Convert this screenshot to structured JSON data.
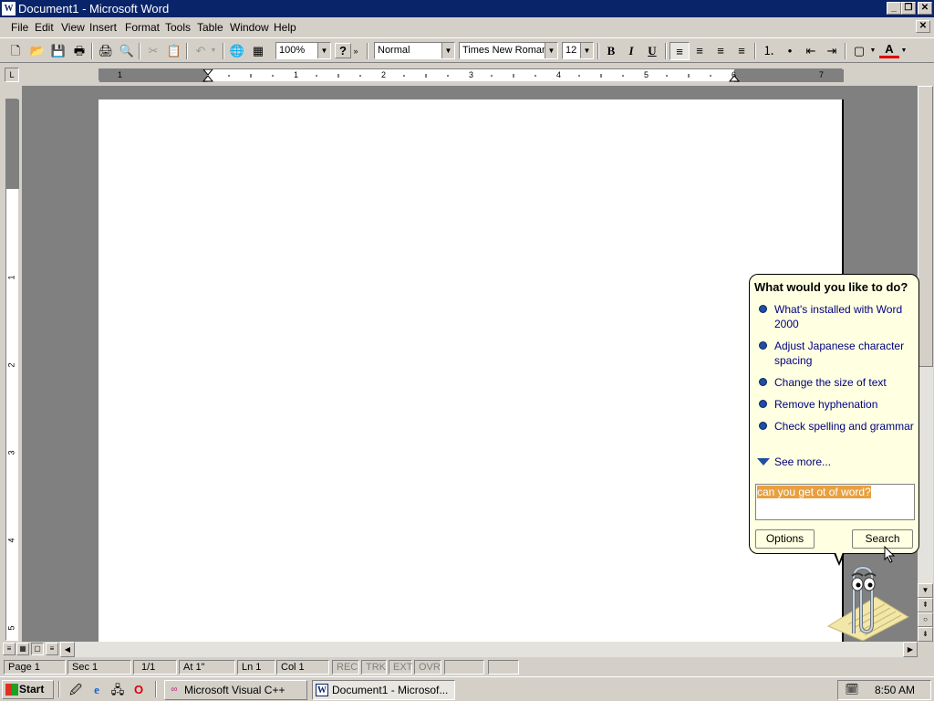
{
  "window": {
    "title": "Document1 - Microsoft Word",
    "app_icon_glyph": "W",
    "minimize_glyph": "_",
    "maximize_glyph": "❐",
    "close_glyph": "✕"
  },
  "menubar": {
    "items": [
      "File",
      "Edit",
      "View",
      "Insert",
      "Format",
      "Tools",
      "Table",
      "Window",
      "Help"
    ],
    "doc_close_glyph": "✕"
  },
  "toolbar": {
    "zoom": "100%",
    "style": "Normal",
    "font": "Times New Roman",
    "font_size": "12",
    "bold": "B",
    "italic": "I",
    "underline": "U",
    "font_color_glyph": "A",
    "help_glyph": "?",
    "dropdown_glyph": "▼",
    "overflow_glyph": "»",
    "icons": {
      "new": "🗋",
      "open": "📂",
      "save": "💾",
      "print_direct": "🖶",
      "print": "🖨",
      "preview": "🔍",
      "cut": "✂",
      "paste": "📋",
      "undo": "↶",
      "web": "🌐",
      "table": "▦",
      "align_left": "≡",
      "center": "≡",
      "align_right": "≡",
      "justify": "≡",
      "numbering": "⒈",
      "bullets": "•",
      "decrease_indent": "⇤",
      "increase_indent": "⇥",
      "borders": "▢"
    }
  },
  "ruler": {
    "corner_glyph": "L",
    "h_numbers": [
      "1",
      "1",
      "2",
      "3",
      "4",
      "5",
      "6",
      "7"
    ],
    "v_numbers": [
      "1",
      "2",
      "3",
      "4",
      "5"
    ]
  },
  "statusbar": {
    "page": "Page 1",
    "sec": "Sec 1",
    "pages": "1/1",
    "at": "At 1\"",
    "ln": "Ln 1",
    "col": "Col 1",
    "rec": "REC",
    "trk": "TRK",
    "ext": "EXT",
    "ovr": "OVR"
  },
  "assistant": {
    "question": "What would you like to do?",
    "topics": [
      "What's installed with Word 2000",
      "Adjust Japanese character spacing",
      "Change the size of text",
      "Remove hyphenation",
      "Check spelling and grammar"
    ],
    "see_more": "See more...",
    "query": "can you get ot of word?",
    "options_label": "Options",
    "search_label": "Search"
  },
  "scroll": {
    "up": "▲",
    "down": "▼",
    "left": "◀",
    "right": "▶",
    "prev_page": "⇞",
    "browse": "○",
    "next_page": "⇟"
  },
  "taskbar": {
    "start_label": "Start",
    "tasks": [
      "Microsoft Visual C++",
      "Document1 - Microsof..."
    ],
    "time": "8:50 AM",
    "quicklaunch": [
      "🖉",
      "e",
      "🖧",
      "O"
    ]
  }
}
